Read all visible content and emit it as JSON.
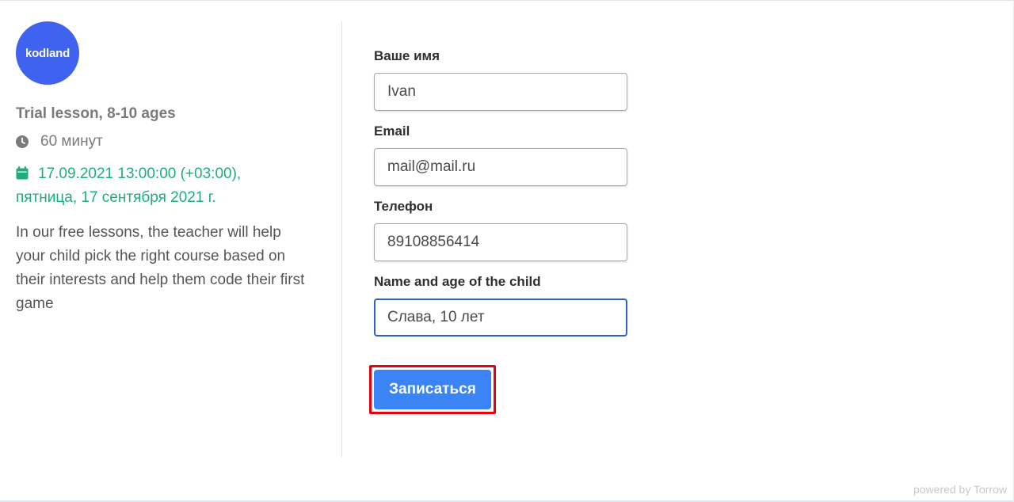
{
  "brand": {
    "logo_text": "kodland",
    "color": "#3f63ef"
  },
  "event": {
    "title": "Trial lesson, 8-10 ages",
    "duration": "60 минут",
    "datetime": "17.09.2021 13:00:00 (+03:00),",
    "weekday_date": "пятница, 17 сентября 2021 г.",
    "description": "In our free lessons, the teacher will help your child pick the right course based on their interests and help them code their first game",
    "accent_color": "#1fae7b"
  },
  "form": {
    "name": {
      "label": "Ваше имя",
      "value": "Ivan"
    },
    "email": {
      "label": "Email",
      "value": "mail@mail.ru"
    },
    "phone": {
      "label": "Телефон",
      "value": "89108856414"
    },
    "child": {
      "label": "Name and age of the child",
      "value": "Слава, 10 лет"
    },
    "submit_label": "Записаться",
    "submit_color": "#3b84f5",
    "highlight_color": "#e8000f"
  },
  "footer": {
    "powered_by": "powered by Torrow"
  }
}
